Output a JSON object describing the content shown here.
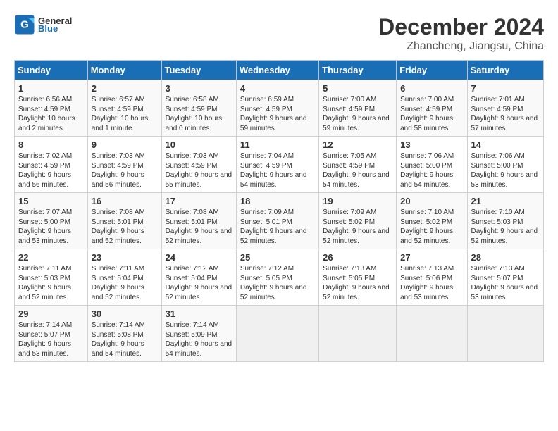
{
  "header": {
    "logo_general": "General",
    "logo_blue": "Blue",
    "month_title": "December 2024",
    "location": "Zhancheng, Jiangsu, China"
  },
  "days_of_week": [
    "Sunday",
    "Monday",
    "Tuesday",
    "Wednesday",
    "Thursday",
    "Friday",
    "Saturday"
  ],
  "weeks": [
    [
      {
        "day": "1",
        "sunrise": "6:56 AM",
        "sunset": "4:59 PM",
        "daylight": "10 hours and 2 minutes."
      },
      {
        "day": "2",
        "sunrise": "6:57 AM",
        "sunset": "4:59 PM",
        "daylight": "10 hours and 1 minute."
      },
      {
        "day": "3",
        "sunrise": "6:58 AM",
        "sunset": "4:59 PM",
        "daylight": "10 hours and 0 minutes."
      },
      {
        "day": "4",
        "sunrise": "6:59 AM",
        "sunset": "4:59 PM",
        "daylight": "9 hours and 59 minutes."
      },
      {
        "day": "5",
        "sunrise": "7:00 AM",
        "sunset": "4:59 PM",
        "daylight": "9 hours and 59 minutes."
      },
      {
        "day": "6",
        "sunrise": "7:00 AM",
        "sunset": "4:59 PM",
        "daylight": "9 hours and 58 minutes."
      },
      {
        "day": "7",
        "sunrise": "7:01 AM",
        "sunset": "4:59 PM",
        "daylight": "9 hours and 57 minutes."
      }
    ],
    [
      {
        "day": "8",
        "sunrise": "7:02 AM",
        "sunset": "4:59 PM",
        "daylight": "9 hours and 56 minutes."
      },
      {
        "day": "9",
        "sunrise": "7:03 AM",
        "sunset": "4:59 PM",
        "daylight": "9 hours and 56 minutes."
      },
      {
        "day": "10",
        "sunrise": "7:03 AM",
        "sunset": "4:59 PM",
        "daylight": "9 hours and 55 minutes."
      },
      {
        "day": "11",
        "sunrise": "7:04 AM",
        "sunset": "4:59 PM",
        "daylight": "9 hours and 54 minutes."
      },
      {
        "day": "12",
        "sunrise": "7:05 AM",
        "sunset": "4:59 PM",
        "daylight": "9 hours and 54 minutes."
      },
      {
        "day": "13",
        "sunrise": "7:06 AM",
        "sunset": "5:00 PM",
        "daylight": "9 hours and 54 minutes."
      },
      {
        "day": "14",
        "sunrise": "7:06 AM",
        "sunset": "5:00 PM",
        "daylight": "9 hours and 53 minutes."
      }
    ],
    [
      {
        "day": "15",
        "sunrise": "7:07 AM",
        "sunset": "5:00 PM",
        "daylight": "9 hours and 53 minutes."
      },
      {
        "day": "16",
        "sunrise": "7:08 AM",
        "sunset": "5:01 PM",
        "daylight": "9 hours and 52 minutes."
      },
      {
        "day": "17",
        "sunrise": "7:08 AM",
        "sunset": "5:01 PM",
        "daylight": "9 hours and 52 minutes."
      },
      {
        "day": "18",
        "sunrise": "7:09 AM",
        "sunset": "5:01 PM",
        "daylight": "9 hours and 52 minutes."
      },
      {
        "day": "19",
        "sunrise": "7:09 AM",
        "sunset": "5:02 PM",
        "daylight": "9 hours and 52 minutes."
      },
      {
        "day": "20",
        "sunrise": "7:10 AM",
        "sunset": "5:02 PM",
        "daylight": "9 hours and 52 minutes."
      },
      {
        "day": "21",
        "sunrise": "7:10 AM",
        "sunset": "5:03 PM",
        "daylight": "9 hours and 52 minutes."
      }
    ],
    [
      {
        "day": "22",
        "sunrise": "7:11 AM",
        "sunset": "5:03 PM",
        "daylight": "9 hours and 52 minutes."
      },
      {
        "day": "23",
        "sunrise": "7:11 AM",
        "sunset": "5:04 PM",
        "daylight": "9 hours and 52 minutes."
      },
      {
        "day": "24",
        "sunrise": "7:12 AM",
        "sunset": "5:04 PM",
        "daylight": "9 hours and 52 minutes."
      },
      {
        "day": "25",
        "sunrise": "7:12 AM",
        "sunset": "5:05 PM",
        "daylight": "9 hours and 52 minutes."
      },
      {
        "day": "26",
        "sunrise": "7:13 AM",
        "sunset": "5:05 PM",
        "daylight": "9 hours and 52 minutes."
      },
      {
        "day": "27",
        "sunrise": "7:13 AM",
        "sunset": "5:06 PM",
        "daylight": "9 hours and 53 minutes."
      },
      {
        "day": "28",
        "sunrise": "7:13 AM",
        "sunset": "5:07 PM",
        "daylight": "9 hours and 53 minutes."
      }
    ],
    [
      {
        "day": "29",
        "sunrise": "7:14 AM",
        "sunset": "5:07 PM",
        "daylight": "9 hours and 53 minutes."
      },
      {
        "day": "30",
        "sunrise": "7:14 AM",
        "sunset": "5:08 PM",
        "daylight": "9 hours and 54 minutes."
      },
      {
        "day": "31",
        "sunrise": "7:14 AM",
        "sunset": "5:09 PM",
        "daylight": "9 hours and 54 minutes."
      },
      null,
      null,
      null,
      null
    ]
  ],
  "labels": {
    "sunrise": "Sunrise:",
    "sunset": "Sunset:",
    "daylight": "Daylight:"
  }
}
